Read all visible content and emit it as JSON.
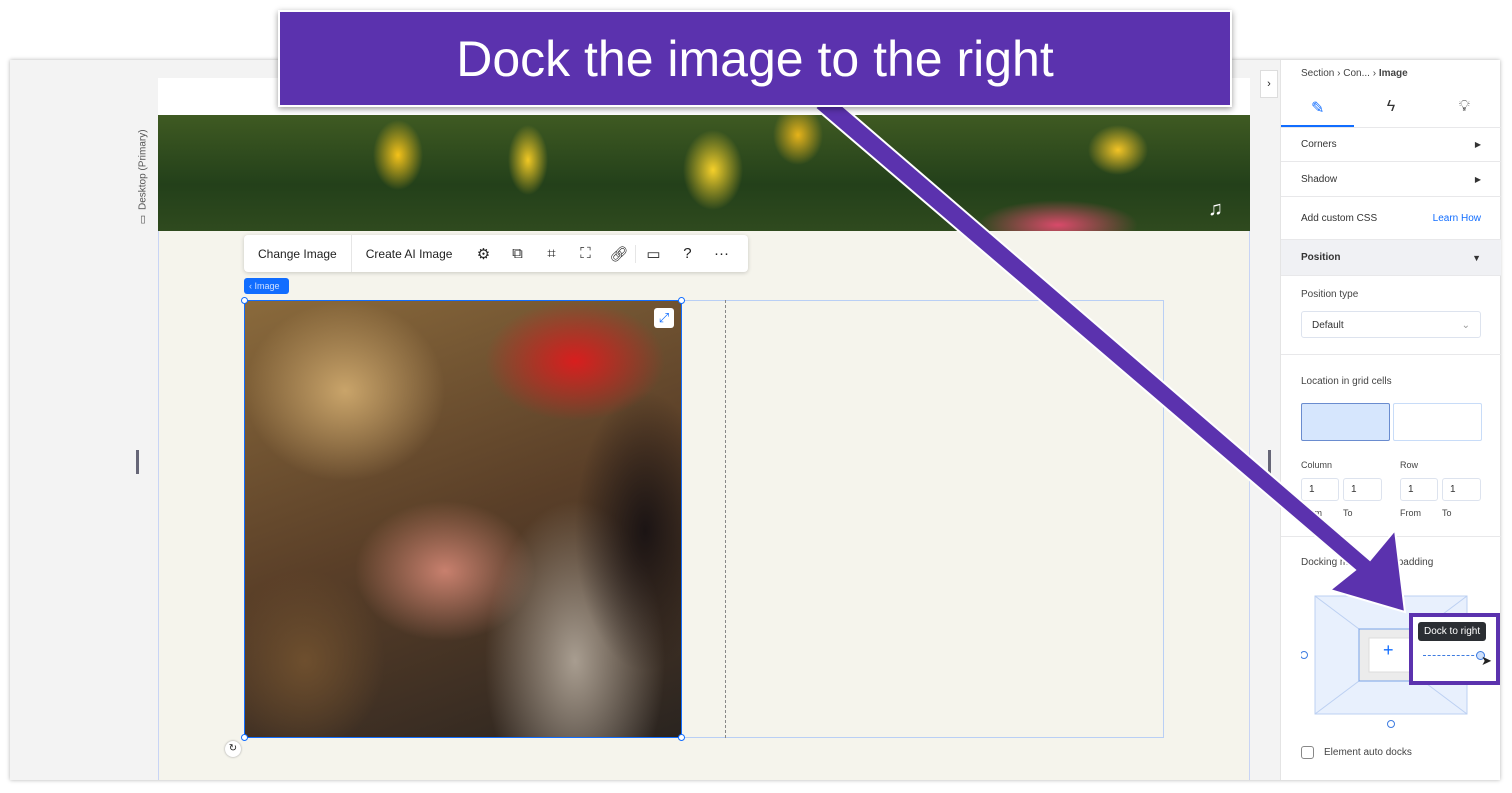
{
  "canvas": {
    "view_label": "Desktop (Primary)",
    "image_tag": "Image"
  },
  "toolbar": {
    "change_image": "Change Image",
    "create_ai_image": "Create AI Image",
    "icons": [
      "gear-icon",
      "duplicate-icon",
      "crop-icon",
      "focus-icon",
      "link-icon",
      "comment-icon",
      "help-icon",
      "more-icon"
    ]
  },
  "panel": {
    "breadcrumb": [
      "Section",
      "Con...",
      "Image"
    ],
    "tabs": [
      "design-icon",
      "interactions-icon",
      "ideas-icon"
    ],
    "corners": "Corners",
    "shadow": "Shadow",
    "custom_css": "Add custom CSS",
    "learn_how": "Learn How",
    "position": "Position",
    "position_type_label": "Position type",
    "position_type_value": "Default",
    "location_label": "Location in grid cells",
    "column_label": "Column",
    "row_label": "Row",
    "col_from": "1",
    "col_to": "1",
    "row_from": "1",
    "row_to": "1",
    "from": "From",
    "to": "To",
    "docking_label": "Docking margins and padding",
    "tooltip": "Dock to right",
    "auto_docks": "Element auto docks"
  },
  "annotation": {
    "headline": "Dock the image to the right",
    "color": "#5b32ae"
  }
}
